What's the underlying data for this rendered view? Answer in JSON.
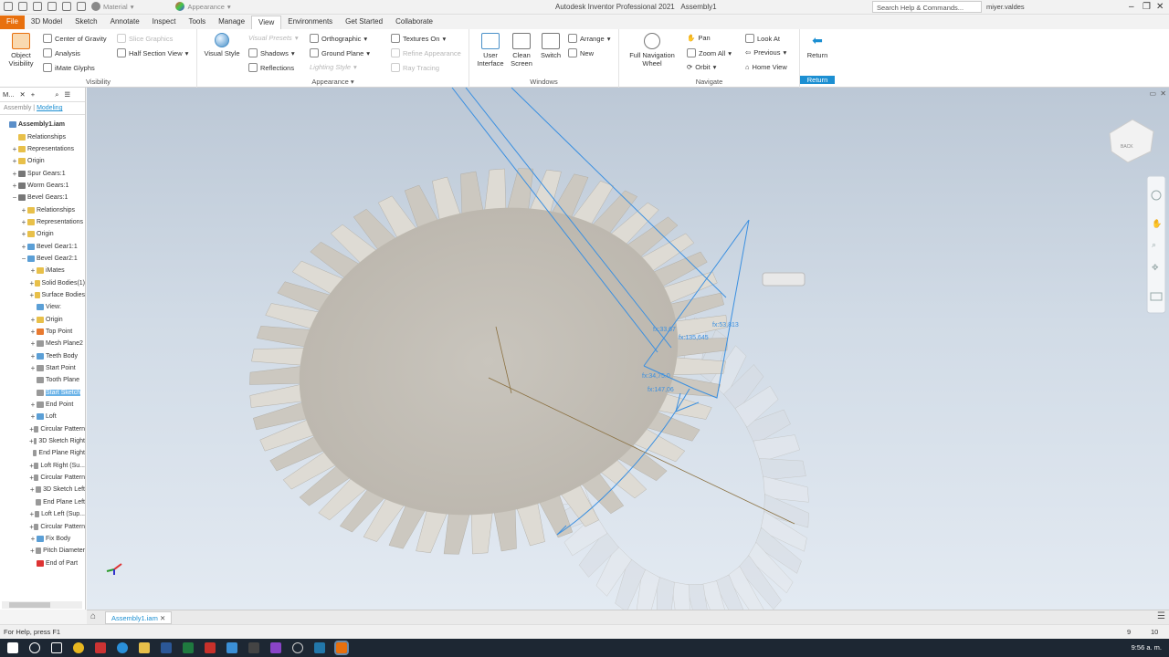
{
  "window": {
    "title": "Autodesk Inventor Professional 2021",
    "document": "Assembly1",
    "search_placeholder": "Search Help & Commands...",
    "user": "miyer.valdes"
  },
  "qat": {
    "material": "Material",
    "appearance": "Appearance"
  },
  "tabs": [
    "File",
    "3D Model",
    "Sketch",
    "Annotate",
    "Inspect",
    "Tools",
    "Manage",
    "View",
    "Environments",
    "Get Started",
    "Collaborate"
  ],
  "active_tab": "View",
  "ribbon": {
    "visibility": {
      "title": "Visibility",
      "object_visibility": "Object\nVisibility",
      "center_of_gravity": "Center of Gravity",
      "analysis": "Analysis",
      "imate_glyphs": "iMate Glyphs",
      "slice_graphics": "Slice Graphics",
      "half_section": "Half Section View"
    },
    "appearance": {
      "title": "Appearance",
      "visual_style": "Visual Style",
      "visual_presets": "Visual Presets",
      "shadows": "Shadows",
      "reflections": "Reflections",
      "orthographic": "Orthographic",
      "ground_plane": "Ground Plane",
      "lighting_style": "Lighting Style",
      "textures_on": "Textures On",
      "refine_appearance": "Refine Appearance",
      "ray_tracing": "Ray Tracing"
    },
    "windows": {
      "title": "Windows",
      "user_interface": "User\nInterface",
      "clean_screen": "Clean\nScreen",
      "switch": "Switch",
      "arrange": "Arrange",
      "new": "New"
    },
    "navigate": {
      "title": "Navigate",
      "full_nav": "Full Navigation\nWheel",
      "pan": "Pan",
      "zoom_all": "Zoom All",
      "orbit": "Orbit",
      "look_at": "Look At",
      "previous": "Previous",
      "home_view": "Home View"
    },
    "return": {
      "title": "Return",
      "label": "Return"
    }
  },
  "browser": {
    "head": "M...",
    "tab_assembly": "Assembly",
    "tab_modeling": "Modeling",
    "nodes": [
      {
        "label": "Assembly1.iam",
        "level": 0,
        "ex": "",
        "color": "#5b8fc9"
      },
      {
        "label": "Relationships",
        "level": 1,
        "ex": "",
        "color": "#e8c04a"
      },
      {
        "label": "Representations",
        "level": 1,
        "ex": "+",
        "color": "#e8c04a"
      },
      {
        "label": "Origin",
        "level": 1,
        "ex": "+",
        "color": "#e8c04a"
      },
      {
        "label": "Spur Gears:1",
        "level": 1,
        "ex": "+",
        "color": "#777"
      },
      {
        "label": "Worm Gears:1",
        "level": 1,
        "ex": "+",
        "color": "#777"
      },
      {
        "label": "Bevel Gears:1",
        "level": 1,
        "ex": "−",
        "color": "#777"
      },
      {
        "label": "Relationships",
        "level": 2,
        "ex": "+",
        "color": "#e8c04a"
      },
      {
        "label": "Representations",
        "level": 2,
        "ex": "+",
        "color": "#e8c04a"
      },
      {
        "label": "Origin",
        "level": 2,
        "ex": "+",
        "color": "#e8c04a"
      },
      {
        "label": "Bevel Gear1:1",
        "level": 2,
        "ex": "+",
        "color": "#5b9fd6"
      },
      {
        "label": "Bevel Gear2:1",
        "level": 2,
        "ex": "−",
        "color": "#5b9fd6"
      },
      {
        "label": "iMates",
        "level": 3,
        "ex": "+",
        "color": "#e8c04a"
      },
      {
        "label": "Solid Bodies(1)",
        "level": 3,
        "ex": "+",
        "color": "#e8c04a"
      },
      {
        "label": "Surface Bodies",
        "level": 3,
        "ex": "+",
        "color": "#e8c04a"
      },
      {
        "label": "View:",
        "level": 3,
        "ex": "",
        "color": "#5b9fd6"
      },
      {
        "label": "Origin",
        "level": 3,
        "ex": "+",
        "color": "#e8c04a"
      },
      {
        "label": "Top Point",
        "level": 3,
        "ex": "+",
        "color": "#e87a30"
      },
      {
        "label": "Mesh Plane2",
        "level": 3,
        "ex": "+",
        "color": "#999"
      },
      {
        "label": "Teeth Body",
        "level": 3,
        "ex": "+",
        "color": "#5b9fd6"
      },
      {
        "label": "Start Point",
        "level": 3,
        "ex": "+",
        "color": "#999"
      },
      {
        "label": "Tooth Plane",
        "level": 3,
        "ex": "",
        "color": "#999"
      },
      {
        "label": "Start Sketch",
        "level": 3,
        "ex": "",
        "color": "#999",
        "sel": true
      },
      {
        "label": "End Point",
        "level": 3,
        "ex": "+",
        "color": "#999"
      },
      {
        "label": "Loft",
        "level": 3,
        "ex": "+",
        "color": "#5b9fd6"
      },
      {
        "label": "Circular Pattern",
        "level": 3,
        "ex": "+",
        "color": "#999"
      },
      {
        "label": "3D Sketch Right",
        "level": 3,
        "ex": "+",
        "color": "#999"
      },
      {
        "label": "End Plane Right",
        "level": 3,
        "ex": "",
        "color": "#999"
      },
      {
        "label": "Loft Right (Su...",
        "level": 3,
        "ex": "+",
        "color": "#999"
      },
      {
        "label": "Circular Pattern",
        "level": 3,
        "ex": "+",
        "color": "#999"
      },
      {
        "label": "3D Sketch Left",
        "level": 3,
        "ex": "+",
        "color": "#999"
      },
      {
        "label": "End Plane Left",
        "level": 3,
        "ex": "",
        "color": "#999"
      },
      {
        "label": "Loft Left (Sup...",
        "level": 3,
        "ex": "+",
        "color": "#999"
      },
      {
        "label": "Circular Pattern",
        "level": 3,
        "ex": "+",
        "color": "#999"
      },
      {
        "label": "Fix Body",
        "level": 3,
        "ex": "+",
        "color": "#5b9fd6"
      },
      {
        "label": "Pitch Diameter",
        "level": 3,
        "ex": "+",
        "color": "#999"
      },
      {
        "label": "End of Part",
        "level": 3,
        "ex": "",
        "color": "#d33"
      }
    ]
  },
  "viewport": {
    "dims": [
      "fx:33,67",
      "fx:53,813",
      "fx:135,645",
      "fx:34,75.0",
      "fx:147,06"
    ],
    "viewcube": "BACK"
  },
  "doc_tab": "Assembly1.iam",
  "status": {
    "help": "For Help, press F1",
    "n1": "9",
    "n2": "10"
  },
  "clock": "9:56 a. m.",
  "colors": {
    "accent": "#1c8fd2",
    "file_tab": "#e8700e",
    "gear": "#cfcac0",
    "sketch": "#3a8fe0"
  }
}
